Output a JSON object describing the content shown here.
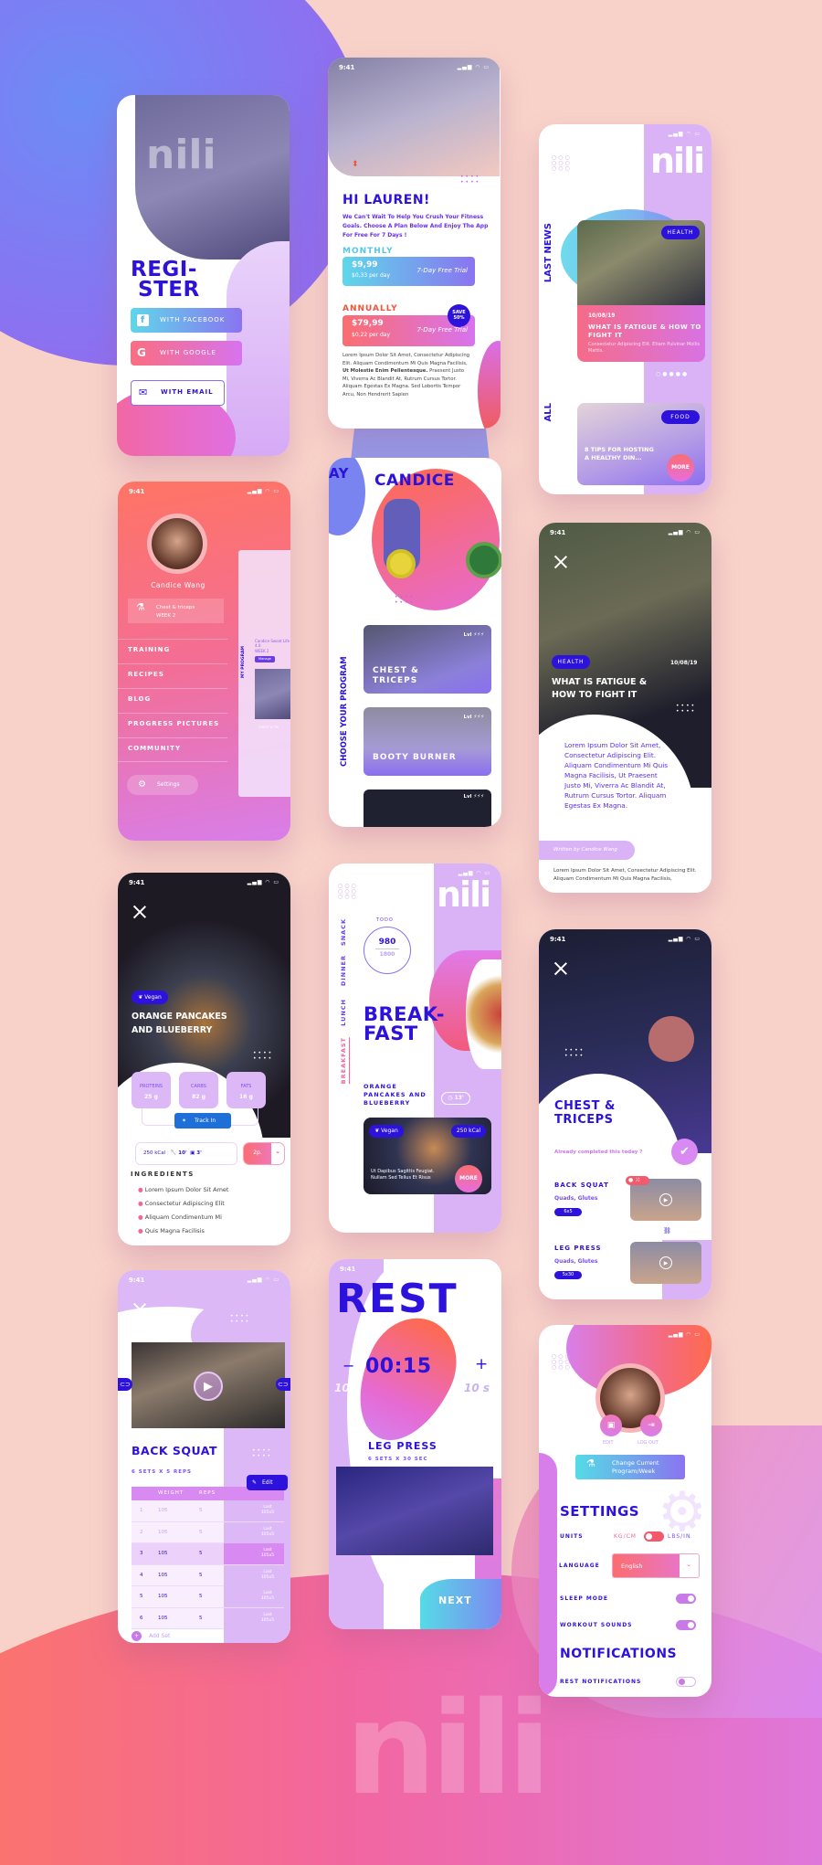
{
  "colors": {
    "primary": "#2d12db",
    "accent_purple": "#d9b3f6",
    "accent_pink": "#f2669a",
    "accent_orange": "#ff6a4d",
    "accent_cyan": "#55dbe6",
    "background": "#f8d2c9"
  },
  "brand": {
    "logo": "nili"
  },
  "register": {
    "title_line1": "REGI-",
    "title_line2": "STER",
    "facebook": "WITH FACEBOOK",
    "google": "WITH GOOGLE",
    "email": "WITH EMAIL"
  },
  "welcome": {
    "time": "9:41",
    "greeting": "HI LAUREN!",
    "intro": "We Can't Wait To Help You Crush Your Fitness Goals. Choose A Plan Below And Enjoy The App For Free For 7 Days !",
    "monthly": {
      "label": "MONTHLY",
      "price": "$9,99",
      "per_day": "$0,33 per day",
      "trial": "7-Day Free Trial"
    },
    "annually": {
      "label": "ANNUALLY",
      "price": "$79,99",
      "per_day": "$0,22 per day",
      "trial": "7-Day Free Trial",
      "badge_line1": "SAVE",
      "badge_line2": "50%"
    },
    "body_start": "Lorem Ipsum Dolor Sit Amet, Consectetur Adipiscing Elit. Aliquam Condimentum Mi Quis Magna Facilisis, ",
    "body_bold": "Ut Molestie Enim Pellentesque.",
    "body_end": " Praesent Justo Mi, Viverra Ac Blandit At, Rutrum Cursus Tortor. Aliquam Egestas Ex Magna. Sed Lobortis Tempor Arcu, Non Hendrerit Sapien"
  },
  "news": {
    "section_latest": "LAST NEWS",
    "section_all": "ALL",
    "featured": {
      "tag": "HEALTH",
      "date": "10/08/19",
      "title": "WHAT IS FATIGUE & HOW TO FIGHT IT",
      "subtitle": "Consectetur Adipiscing Elit. Etiam Pulvinar Mollis Mattis."
    },
    "second": {
      "tag": "FOOD",
      "title": "8 TIPS FOR HOSTING A HEALTHY DIN...",
      "more": "MORE"
    }
  },
  "menu": {
    "time": "9:41",
    "user": "Candice Wang",
    "program": "Chest & triceps",
    "week": "WEEK 2",
    "items": [
      "TRAINING",
      "RECIPES",
      "BLOG",
      "PROGRESS PICTURES",
      "COMMUNITY"
    ],
    "settings": "Settings",
    "preview": {
      "label": "MY PROGRAM",
      "title": "Candice Sweat Life 4.0",
      "week": "WEEK 2",
      "button": "Manage",
      "card": "CHEST & TRI"
    }
  },
  "program": {
    "time": "9:41",
    "prev_title": "AY",
    "title": "CANDICE",
    "section": "CHOOSE YOUR PROGRAM",
    "level_label": "Lvl",
    "cards": [
      {
        "title": "CHEST & TRICEPS"
      },
      {
        "title": "BOOTY BURNER"
      }
    ]
  },
  "article": {
    "time": "9:41",
    "tag": "HEALTH",
    "date": "10/08/19",
    "title": "WHAT IS FATIGUE & HOW TO FIGHT IT",
    "lead": "Lorem Ipsum Dolor Sit Amet, Consectetur Adipiscing Elit. Aliquam Condimentum Mi Quis Magna Facilisis, Ut Praesent Justo Mi, Viverra Ac Blandit At, Rutrum Cursus Tortor. Aliquam Egestas Ex Magna.",
    "author": "Written by Candice Wang",
    "body": "Lorem Ipsum Dolor Sit Amet, Consectetur Adipiscing Elit. Aliquam Condimentum Mi Quis Magna Facilisis,"
  },
  "recipe": {
    "time": "9:41",
    "tag": "Vegan",
    "title": "ORANGE PANCAKES AND BLUEBERRY",
    "macros": [
      {
        "label": "PROTEINS",
        "value": "25 g"
      },
      {
        "label": "CARBS",
        "value": "82 g"
      },
      {
        "label": "FATS",
        "value": "16 g"
      }
    ],
    "track_in": "Track In",
    "kcal": "250 kCal",
    "prep_time": "10'",
    "cook_time": "3'",
    "servings": "2p.",
    "ingredients_title": "INGREDIENTS",
    "ingredients": [
      "Lorem Ipsum Dolor Sit Amet",
      "Consectetur Adipiscing Elit",
      "Aliquam Condimentum Mi",
      "Quis Magna Facilisis"
    ]
  },
  "meals": {
    "tabs": [
      "SNACK",
      "DINNER",
      "LUNCH",
      "BREAKFAST"
    ],
    "active_tab": "BREAKFAST",
    "todo_label": "TODO",
    "consumed": "980",
    "goal": "1800",
    "title_line1": "BREAK-",
    "title_line2": "FAST",
    "dish": "ORANGE PANCAKES AND BLUEBERRY",
    "time": "13'",
    "card": {
      "tag": "Vegan",
      "kcal": "250 kCal",
      "text": "Ut Dapibus Sagittis Feugiat. Nullam Sed Tellus Et Risus",
      "more": "MORE"
    }
  },
  "workout": {
    "time": "9:41",
    "title": "CHEST & TRICEPS",
    "completed_prompt": "Already completed this today ?",
    "exercises": [
      {
        "name": "BACK SQUAT",
        "muscles": "Quads, Glutes",
        "badge": "6x5"
      },
      {
        "name": "LEG PRESS",
        "muscles": "Quads, Glutes",
        "badge": "5x30"
      }
    ]
  },
  "exercise": {
    "time": "9:41",
    "title": "BACK SQUAT",
    "subtitle": "6 SETS X 5 REPS",
    "edit": "Edit",
    "columns": [
      "WEIGHT",
      "REPS"
    ],
    "sets": [
      {
        "n": "1",
        "weight": "105",
        "reps": "5",
        "last": "Last 105x5"
      },
      {
        "n": "2",
        "weight": "105",
        "reps": "5",
        "last": "Last 105x5"
      },
      {
        "n": "3",
        "weight": "105",
        "reps": "5",
        "last": "Last 105x5"
      },
      {
        "n": "4",
        "weight": "105",
        "reps": "5",
        "last": "Last 105x5"
      },
      {
        "n": "5",
        "weight": "105",
        "reps": "5",
        "last": "Last 105x5"
      },
      {
        "n": "6",
        "weight": "105",
        "reps": "5",
        "last": "Last 105x5"
      }
    ],
    "add_set": "Add Set"
  },
  "rest": {
    "time": "9:41",
    "title": "REST",
    "minus": "−",
    "plus": "+",
    "timer": "00:15",
    "minus_step": "10 s",
    "plus_step": "10 s",
    "next_exercise": "LEG PRESS",
    "next_detail": "6 SETS X 30 SEC",
    "next": "NEXT"
  },
  "settings": {
    "edit": "EDIT",
    "logout": "LOG OUT",
    "change_program": "Change Current Program/Week",
    "title": "SETTINGS",
    "units_label": "UNITS",
    "unit_metric": "KG/CM",
    "unit_imperial": "LBS/IN",
    "language_label": "LANGUAGE",
    "language": "English",
    "sleep_mode": "SLEEP MODE",
    "sleep_mode_on": true,
    "workout_sounds": "WORKOUT SOUNDS",
    "workout_sounds_on": true,
    "notifications_title": "NOTIFICATIONS",
    "rest_notifications": "REST NOTIFICATIONS",
    "rest_notifications_on": false
  }
}
